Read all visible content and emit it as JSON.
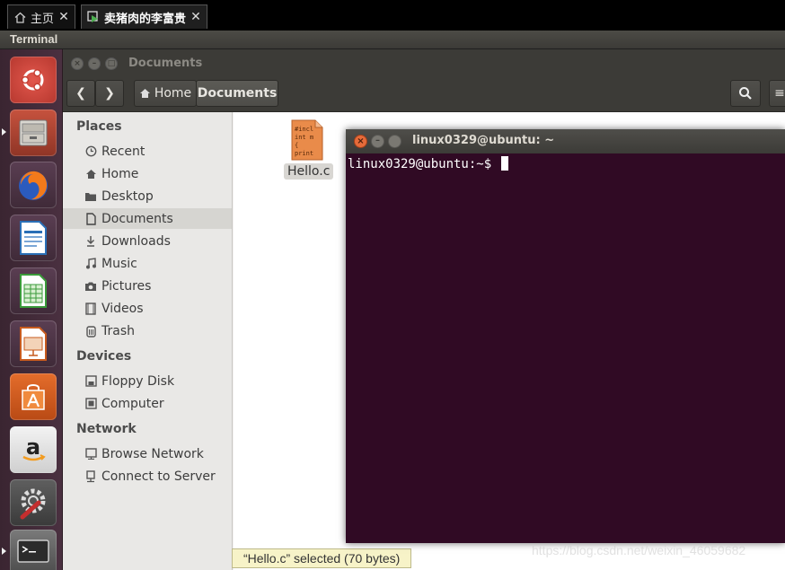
{
  "vm_tabs": [
    {
      "label": "主页",
      "icon": "home-icon"
    },
    {
      "label": "卖猪肉的李富贵",
      "icon": "vm-icon"
    }
  ],
  "top_panel": {
    "title": "Terminal"
  },
  "launcher": {
    "items": [
      "ubuntu-logo-icon",
      "files-icon",
      "firefox-icon",
      "writer-icon",
      "calc-icon",
      "impress-icon",
      "software-center-icon",
      "amazon-icon",
      "settings-icon",
      "terminal-icon"
    ]
  },
  "nautilus": {
    "title": "Documents",
    "path": {
      "home": "Home",
      "current": "Documents"
    },
    "sidebar": {
      "places_title": "Places",
      "places": [
        {
          "label": "Recent",
          "icon": "clock-icon"
        },
        {
          "label": "Home",
          "icon": "home-icon"
        },
        {
          "label": "Desktop",
          "icon": "folder-icon"
        },
        {
          "label": "Documents",
          "icon": "document-icon"
        },
        {
          "label": "Downloads",
          "icon": "download-icon"
        },
        {
          "label": "Music",
          "icon": "music-icon"
        },
        {
          "label": "Pictures",
          "icon": "camera-icon"
        },
        {
          "label": "Videos",
          "icon": "film-icon"
        },
        {
          "label": "Trash",
          "icon": "trash-icon"
        }
      ],
      "devices_title": "Devices",
      "devices": [
        {
          "label": "Floppy Disk",
          "icon": "floppy-icon"
        },
        {
          "label": "Computer",
          "icon": "computer-icon"
        }
      ],
      "network_title": "Network",
      "network": [
        {
          "label": "Browse Network",
          "icon": "network-icon"
        },
        {
          "label": "Connect to Server",
          "icon": "server-icon"
        }
      ]
    },
    "files": [
      {
        "name": "Hello.c",
        "preview": [
          "#incl",
          "int m",
          "{",
          "print"
        ]
      }
    ],
    "status": "“Hello.c” selected  (70 bytes)"
  },
  "terminal": {
    "title": "linux0329@ubuntu: ~",
    "prompt": "linux0329@ubuntu:~$ "
  },
  "watermark": "https://blog.csdn.net/weixin_46059682"
}
